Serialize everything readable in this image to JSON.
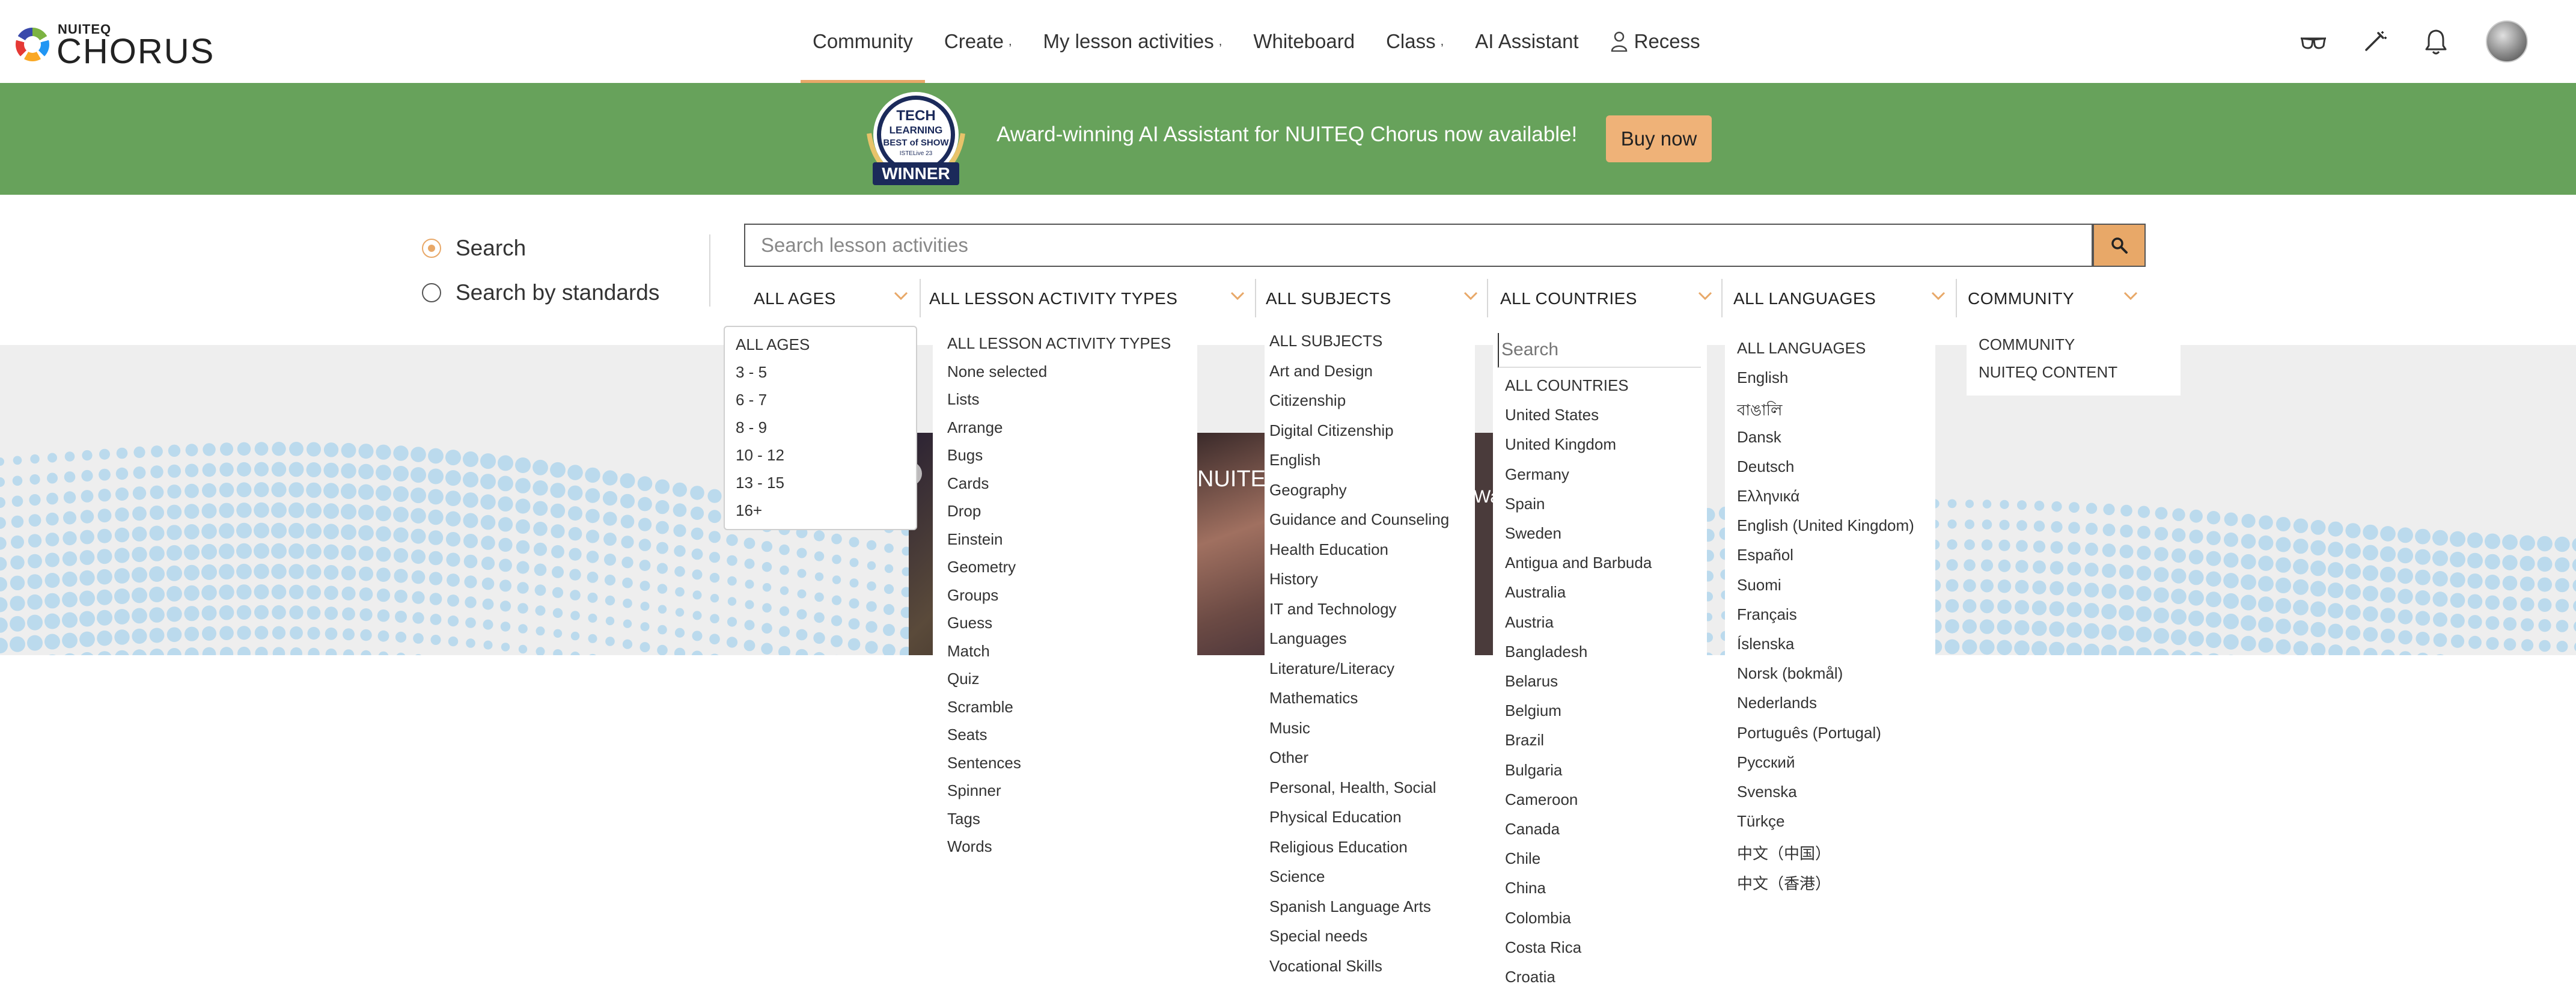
{
  "logo": {
    "small": "NUITEQ",
    "big": "CHORUS"
  },
  "nav": {
    "items": [
      {
        "label": "Community",
        "caret": false,
        "active": true
      },
      {
        "label": "Create",
        "caret": true,
        "active": false
      },
      {
        "label": "My lesson activities",
        "caret": true,
        "active": false
      },
      {
        "label": "Whiteboard",
        "caret": false,
        "active": false
      },
      {
        "label": "Class",
        "caret": true,
        "active": false
      },
      {
        "label": "AI Assistant",
        "caret": false,
        "active": false
      },
      {
        "label": "Recess",
        "caret": false,
        "active": false
      }
    ],
    "caret_glyph": ",",
    "icons": [
      "glasses-icon",
      "magic-wand-icon",
      "bell-icon",
      "avatar"
    ]
  },
  "banner": {
    "badge": {
      "line1": "TECH",
      "line2": "LEARNING",
      "line3": "BEST of SHOW",
      "line4": "ISTELive 23",
      "line5": "WINNER"
    },
    "text": "Award-winning AI Assistant for NUITEQ Chorus now available!",
    "button": "Buy now",
    "color": "#67a25b",
    "button_color": "#efb278"
  },
  "search_mode": {
    "options": [
      {
        "label": "Search",
        "selected": true
      },
      {
        "label": "Search by standards",
        "selected": false
      }
    ]
  },
  "search": {
    "placeholder": "Search lesson activities",
    "accent": "#e8a868"
  },
  "filters": {
    "ages": "ALL AGES",
    "types": "ALL LESSON ACTIVITY TYPES",
    "subjects": "ALL SUBJECTS",
    "countries": "ALL COUNTRIES",
    "languages": "ALL LANGUAGES",
    "community": "COMMUNITY"
  },
  "dropdowns": {
    "ages": [
      "ALL AGES",
      "3 - 5",
      "6 - 7",
      "8 - 9",
      "10 - 12",
      "13 - 15",
      "16+"
    ],
    "types": [
      "ALL LESSON ACTIVITY TYPES",
      "None selected",
      "Lists",
      "Arrange",
      "Bugs",
      "Cards",
      "Drop",
      "Einstein",
      "Geometry",
      "Groups",
      "Guess",
      "Match",
      "Quiz",
      "Scramble",
      "Seats",
      "Sentences",
      "Spinner",
      "Tags",
      "Words"
    ],
    "subjects": [
      "ALL SUBJECTS",
      "Art and Design",
      "Citizenship",
      "Digital Citizenship",
      "English",
      "Geography",
      "Guidance and Counseling",
      "Health Education",
      "History",
      "IT and Technology",
      "Languages",
      "Literature/Literacy",
      "Mathematics",
      "Music",
      "Other",
      "Personal, Health, Social",
      "Physical Education",
      "Religious Education",
      "Science",
      "Spanish Language Arts",
      "Special needs",
      "Vocational Skills"
    ],
    "countries_search_placeholder": "Search",
    "countries": [
      "ALL COUNTRIES",
      "United States",
      "United Kingdom",
      "Germany",
      "Spain",
      "Sweden",
      "Antigua and Barbuda",
      "Australia",
      "Austria",
      "Bangladesh",
      "Belarus",
      "Belgium",
      "Brazil",
      "Bulgaria",
      "Cameroon",
      "Canada",
      "Chile",
      "China",
      "Colombia",
      "Costa Rica",
      "Croatia"
    ],
    "languages": [
      "ALL LANGUAGES",
      "English",
      "বাঙালি",
      "Dansk",
      "Deutsch",
      "Ελληνικά",
      "English (United Kingdom)",
      "Español",
      "Suomi",
      "Français",
      "Íslenska",
      "Norsk (bokmål)",
      "Nederlands",
      "Português (Portugal)",
      "Русский",
      "Svenska",
      "Türkçe",
      "中文（中国）",
      "中文（香港）"
    ],
    "community": [
      "COMMUNITY",
      "NUITEQ CONTENT"
    ]
  },
  "background": {
    "photo_label_1": "NUITE",
    "photo_label_2": "Wat"
  }
}
